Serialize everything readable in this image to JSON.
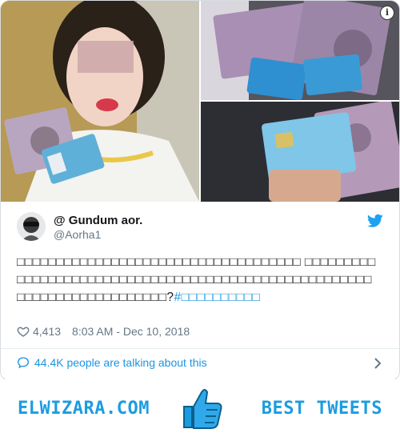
{
  "tweet": {
    "name": "@ Gundum aor.",
    "handle": "@Aorha1",
    "text_main": "□□□□□□□□□□□□□□□□□□□□□□□□□□□□□□□□□□□□ □□□□□□□□□□□□□□□□□□□□□□□□□□□□□□□□□□□□□□□□□□□□□□□□□□□□□□□□□□□□□□□□□□□□□□□□□?",
    "text_tag": "#□□□□□□□□□□",
    "likes": "4,413",
    "timestamp": "8:03 AM - Dec 10, 2018",
    "talking": "44.4K people are talking about this"
  },
  "icons": {
    "info": "info-icon",
    "twitter": "twitter-bird-icon",
    "heart": "heart-icon",
    "comment": "comment-bubble-icon",
    "chevron": "chevron-right-icon",
    "thumb": "thumbs-up-icon"
  },
  "banner": {
    "left": "ELWIZARA.COM",
    "right": "BEST TWEETS"
  },
  "colors": {
    "accent": "#1b95e0",
    "text": "#14171a",
    "muted": "#657786"
  }
}
